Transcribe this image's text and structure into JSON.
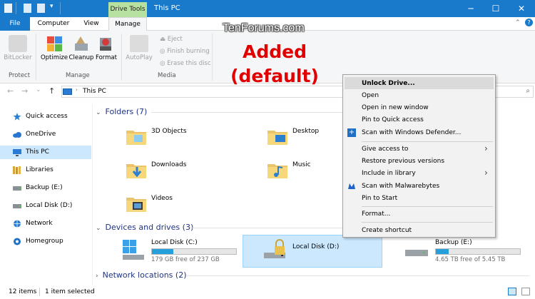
{
  "window": {
    "context_tab_group": "Drive Tools",
    "title": "This PC",
    "minimize_icon": "─",
    "maximize_icon": "☐",
    "close_icon": "✕"
  },
  "tabs": {
    "file": "File",
    "computer": "Computer",
    "view": "View",
    "manage": "Manage"
  },
  "ribbon": {
    "bitlocker": "BitLocker",
    "optimize": "Optimize",
    "cleanup": "Cleanup",
    "format": "Format",
    "autoplay": "AutoPlay",
    "eject": "Eject",
    "finish_burning": "Finish burning",
    "erase_disc": "Erase this disc",
    "group_protect": "Protect",
    "group_manage": "Manage",
    "group_media": "Media"
  },
  "address": {
    "path": "This PC",
    "back": "←",
    "forward": "→",
    "recent": "⌄",
    "up": "↑"
  },
  "sidebar": {
    "items": [
      {
        "label": "Quick access"
      },
      {
        "label": "OneDrive"
      },
      {
        "label": "This PC"
      },
      {
        "label": "Libraries"
      },
      {
        "label": "Backup (E:)"
      },
      {
        "label": "Local Disk (D:)"
      },
      {
        "label": "Network"
      },
      {
        "label": "Homegroup"
      }
    ]
  },
  "content": {
    "folders_header": "Folders (7)",
    "folders": [
      {
        "name": "3D Objects"
      },
      {
        "name": "Desktop"
      },
      {
        "name": "Downloads"
      },
      {
        "name": "Music"
      },
      {
        "name": "Videos"
      }
    ],
    "devices_header": "Devices and drives (3)",
    "drives": [
      {
        "name": "Local Disk (C:)",
        "free": "179 GB free of 237 GB",
        "used_fraction": 0.25
      },
      {
        "name": "Local Disk (D:)"
      },
      {
        "name": "Backup (E:)",
        "free": "4.65 TB free of 5.45 TB",
        "used_fraction": 0.15
      }
    ],
    "network_header": "Network locations (2)"
  },
  "status": {
    "items": "12 items",
    "selected": "1 item selected"
  },
  "context_menu": {
    "items": [
      "Unlock Drive...",
      "Open",
      "Open in new window",
      "Pin to Quick access",
      "Scan with Windows Defender...",
      "Give access to",
      "Restore previous versions",
      "Include in library",
      "Scan with Malwarebytes",
      "Pin to Start",
      "Format...",
      "Create shortcut"
    ],
    "submenu_arrow": "›"
  },
  "annotation": {
    "line1": "Added",
    "line2": "(default)"
  },
  "watermark": "TenForums.com",
  "colors": {
    "title_bar": "#1979ca",
    "drive_tools": "#b7e1a1",
    "selection": "#cce8ff",
    "annotation": "#e00000",
    "usage_bar": "#26a0da"
  }
}
